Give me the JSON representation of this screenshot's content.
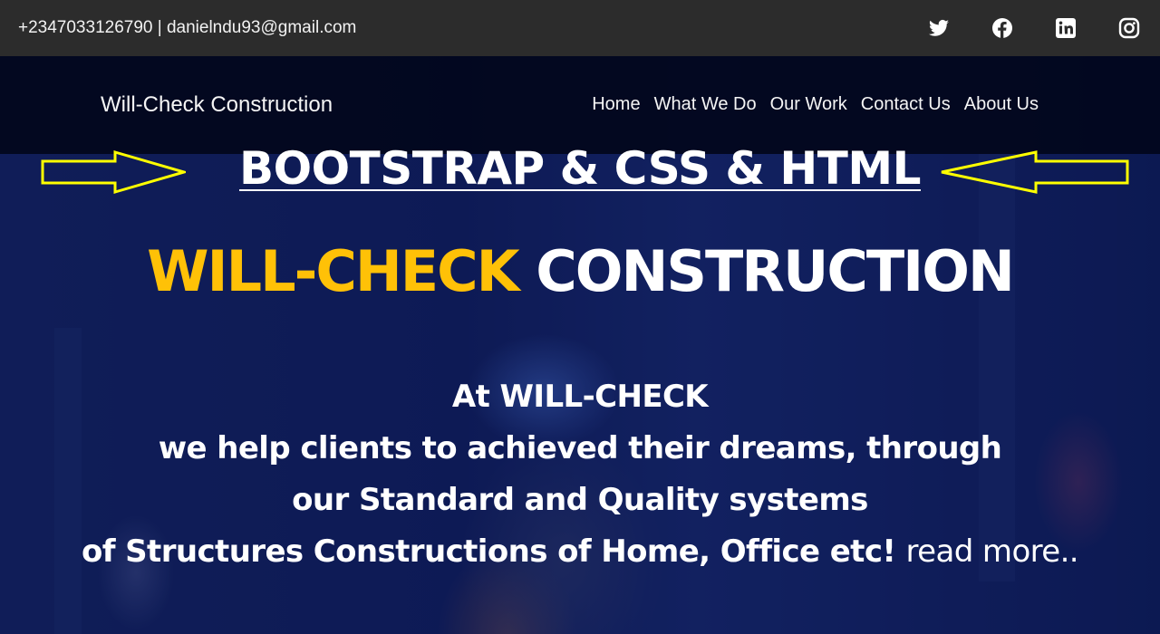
{
  "topbar": {
    "contact": "+2347033126790 | danielndu93@gmail.com",
    "social": [
      {
        "name": "twitter-icon"
      },
      {
        "name": "facebook-icon"
      },
      {
        "name": "linkedin-icon"
      },
      {
        "name": "instagram-icon"
      }
    ]
  },
  "navbar": {
    "brand": "Will-Check Construction",
    "links": [
      "Home",
      "What We Do",
      "Our Work",
      "Contact Us",
      "About Us"
    ]
  },
  "annotation": {
    "title": "BOOTSTRAP & CSS & HTML",
    "arrow_color": "#ffff00"
  },
  "hero": {
    "title_accent": "WILL-CHECK",
    "title_rest": "CONSTRUCTION",
    "accent_color": "#ffc107",
    "lines": [
      "At WILL-CHECK",
      "we help clients to achieved their dreams, through",
      "our Standard and Quality systems",
      "of Structures Constructions of Home, Office etc!"
    ],
    "read_more": "read more.."
  }
}
